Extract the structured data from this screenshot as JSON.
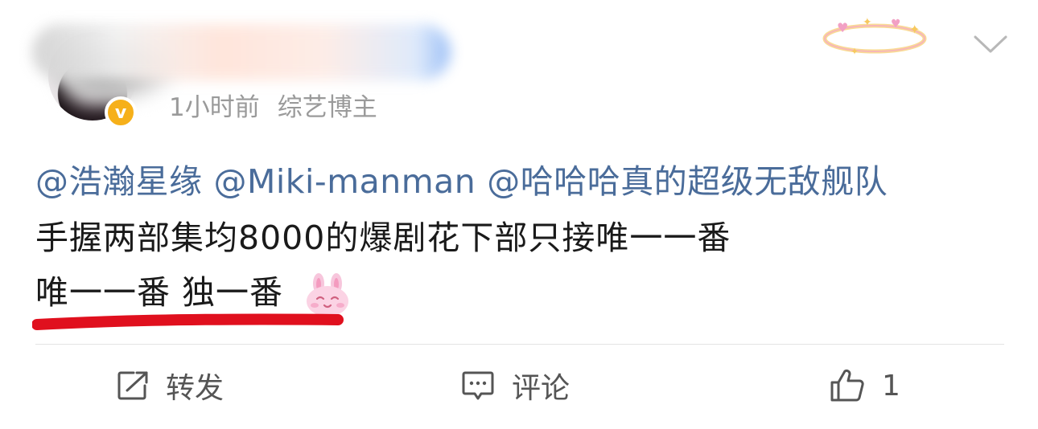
{
  "post": {
    "meta": {
      "time": "1小时前",
      "tag": "综艺博主"
    },
    "mentions": [
      "@浩瀚星缘",
      "@Miki-manman",
      "@哈哈哈真的超级无敌舰队"
    ],
    "text_line1": "手握两部集均8000的爆剧花下部只接唯一一番",
    "text_line2": "唯一一番 独一番",
    "emoji_icon": "pink-bunny-emoji"
  },
  "actions": {
    "repost_label": "转发",
    "comment_label": "评论",
    "like_count": "1"
  },
  "colors": {
    "mention": "#4a6c9a",
    "text": "#1a1a1a",
    "meta": "#9a9a9a",
    "underline": "#e0101e",
    "verified": "#f6b01a"
  }
}
